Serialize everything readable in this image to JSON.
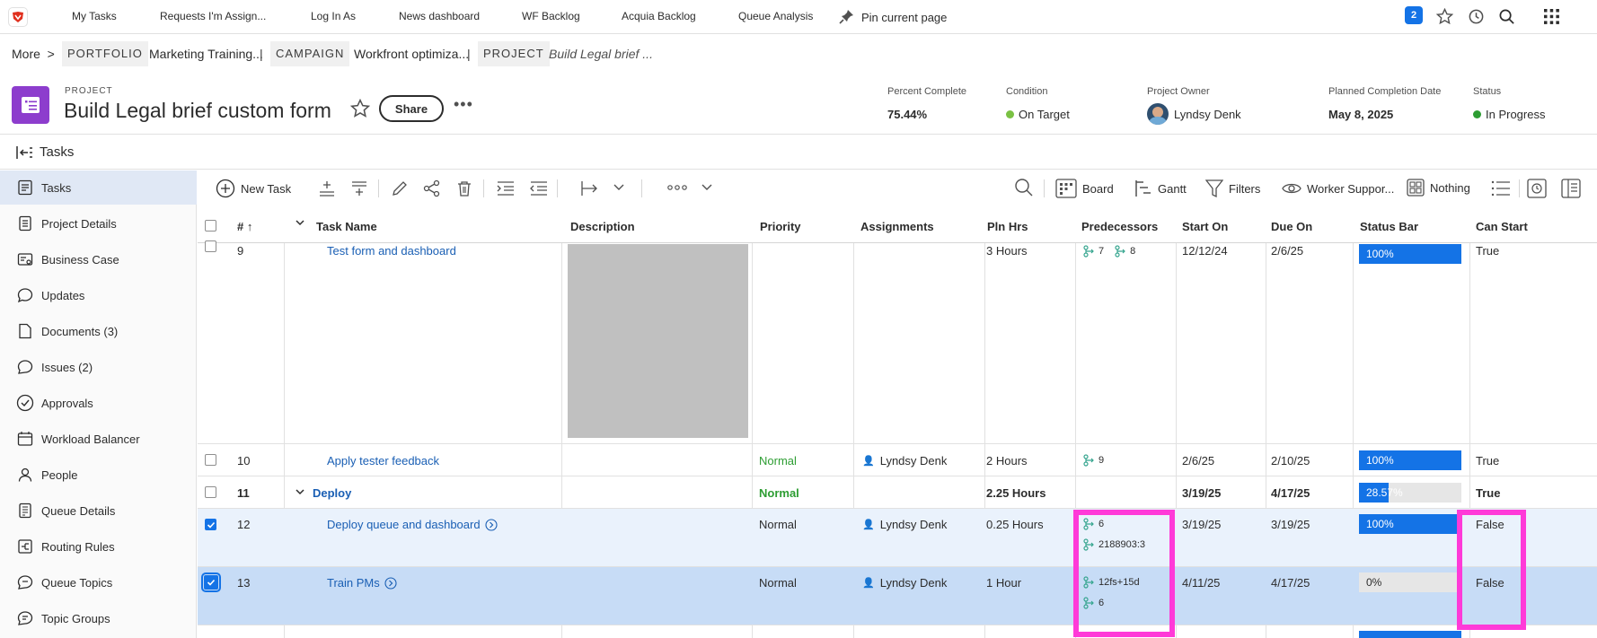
{
  "topnav": {
    "items": [
      "My Tasks",
      "Requests I'm Assign...",
      "Log In As",
      "News dashboard",
      "WF Backlog",
      "Acquia Backlog",
      "Queue Analysis"
    ],
    "pin_label": "Pin current page",
    "notifications_count": "2"
  },
  "breadcrumb": {
    "more": "More",
    "portfolio_tag": "PORTFOLIO",
    "portfolio_name": "Marketing Training...",
    "campaign_tag": "CAMPAIGN",
    "campaign_name": "Workfront optimiza...",
    "project_tag": "PROJECT",
    "project_name": "Build Legal brief ..."
  },
  "project": {
    "kicker": "PROJECT",
    "title": "Build Legal brief custom form",
    "share_label": "Share",
    "more": "•••",
    "percent_complete_label": "Percent Complete",
    "percent_complete": "75.44%",
    "condition_label": "Condition",
    "condition": "On Target",
    "owner_label": "Project Owner",
    "owner": "Lyndsy Denk",
    "planned_completion_label": "Planned Completion Date",
    "planned_completion": "May 8, 2025",
    "status_label": "Status",
    "status": "In Progress",
    "colors": {
      "condition": "#7ac143",
      "status": "#2d9d32",
      "icon": "#8d3dcd"
    }
  },
  "section": {
    "title": "Tasks"
  },
  "sidebar": {
    "items": [
      {
        "label": "Tasks",
        "icon": "tasks-icon"
      },
      {
        "label": "Project Details",
        "icon": "document-icon"
      },
      {
        "label": "Business Case",
        "icon": "business-case-icon"
      },
      {
        "label": "Updates",
        "icon": "chat-icon"
      },
      {
        "label": "Documents (3)",
        "icon": "file-icon"
      },
      {
        "label": "Issues (2)",
        "icon": "issue-icon"
      },
      {
        "label": "Approvals",
        "icon": "check-circle-icon"
      },
      {
        "label": "Workload Balancer",
        "icon": "calendar-icon"
      },
      {
        "label": "People",
        "icon": "person-icon"
      },
      {
        "label": "Queue Details",
        "icon": "queue-icon"
      },
      {
        "label": "Routing Rules",
        "icon": "routing-icon"
      },
      {
        "label": "Queue Topics",
        "icon": "topics-icon"
      },
      {
        "label": "Topic Groups",
        "icon": "group-icon"
      }
    ]
  },
  "toolbar": {
    "new_task": "New Task",
    "board": "Board",
    "gantt": "Gantt",
    "filters": "Filters",
    "worker_support": "Worker Suppor...",
    "nothing": "Nothing"
  },
  "grid": {
    "headers": {
      "num": "#",
      "task_name": "Task Name",
      "description": "Description",
      "priority": "Priority",
      "assignments": "Assignments",
      "pln_hrs": "Pln Hrs",
      "predecessors": "Predecessors",
      "start_on": "Start On",
      "due_on": "Due On",
      "status_bar": "Status Bar",
      "can_start": "Can Start"
    },
    "rows": [
      {
        "num": "9",
        "name": "Test form and dashboard",
        "priority": "",
        "assignee": "",
        "hours": "3 Hours",
        "pred": [
          "7",
          "8"
        ],
        "start": "12/12/24",
        "due": "2/6/25",
        "progress_label": "100%",
        "progress": 1.0,
        "can_start": "True"
      },
      {
        "num": "10",
        "name": "Apply tester feedback",
        "priority": "Normal",
        "assignee": "Lyndsy Denk",
        "hours": "2 Hours",
        "pred": [
          "9"
        ],
        "start": "2/6/25",
        "due": "2/10/25",
        "progress_label": "100%",
        "progress": 1.0,
        "can_start": "True"
      },
      {
        "num": "11",
        "name": "Deploy",
        "priority": "Normal",
        "assignee": "",
        "hours": "2.25 Hours",
        "pred": [],
        "start": "3/19/25",
        "due": "4/17/25",
        "progress_label": "28.57%",
        "progress": 0.2857,
        "can_start": "True"
      },
      {
        "num": "12",
        "name": "Deploy queue and dashboard",
        "priority": "Normal",
        "assignee": "Lyndsy Denk",
        "hours": "0.25 Hours",
        "pred": [
          "6",
          "2188903:3"
        ],
        "start": "3/19/25",
        "due": "3/19/25",
        "progress_label": "100%",
        "progress": 1.0,
        "can_start": "False"
      },
      {
        "num": "13",
        "name": "Train PMs",
        "priority": "Normal",
        "assignee": "Lyndsy Denk",
        "hours": "1 Hour",
        "pred": [
          "12fs+15d",
          "6"
        ],
        "start": "4/11/25",
        "due": "4/17/25",
        "progress_label": "0%",
        "progress": 0.0,
        "can_start": "False"
      }
    ]
  }
}
